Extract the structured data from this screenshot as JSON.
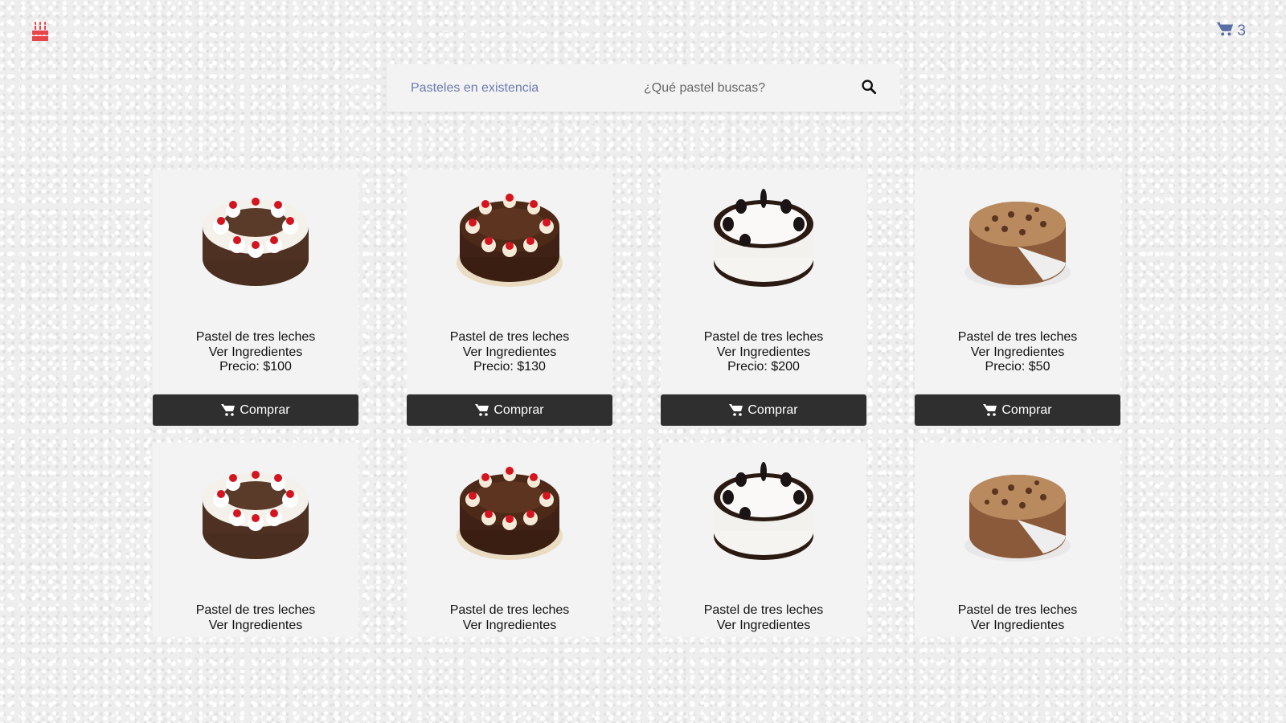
{
  "header": {
    "logo_icon": "birthday-cake-icon",
    "cart_icon": "shopping-cart-icon",
    "cart_count": "3",
    "accent_color": "#5a6fa8",
    "logo_color": "#e8454b"
  },
  "search": {
    "link_label": "Pasteles en existencia",
    "placeholder": "¿Qué pastel buscas?",
    "button_icon": "search-icon"
  },
  "products": [
    {
      "name": "Pastel de tres leches",
      "ingredients_label": "Ver Ingredientes",
      "price": "Precio: $100",
      "buy_label": "Comprar",
      "image": "black-forest-cake"
    },
    {
      "name": "Pastel de tres leches",
      "ingredients_label": "Ver Ingredientes",
      "price": "Precio: $130",
      "buy_label": "Comprar",
      "image": "chocolate-cherry-cake"
    },
    {
      "name": "Pastel de tres leches",
      "ingredients_label": "Ver Ingredientes",
      "price": "Precio: $200",
      "buy_label": "Comprar",
      "image": "cookies-and-cream-cake"
    },
    {
      "name": "Pastel de tres leches",
      "ingredients_label": "Ver Ingredientes",
      "price": "Precio: $50",
      "buy_label": "Comprar",
      "image": "cookie-dough-ice-cream-cake"
    },
    {
      "name": "Pastel de tres leches",
      "ingredients_label": "Ver Ingredientes",
      "image": "black-forest-cake"
    },
    {
      "name": "Pastel de tres leches",
      "ingredients_label": "Ver Ingredientes",
      "image": "chocolate-cherry-cake"
    },
    {
      "name": "Pastel de tres leches",
      "ingredients_label": "Ver Ingredientes",
      "image": "cookies-and-cream-cake"
    },
    {
      "name": "Pastel de tres leches",
      "ingredients_label": "Ver Ingredientes",
      "image": "cookie-dough-ice-cream-cake"
    }
  ],
  "colors": {
    "card_background": "#f3f3f3",
    "button_background": "#2f2f2f",
    "button_text": "#ffffff"
  }
}
